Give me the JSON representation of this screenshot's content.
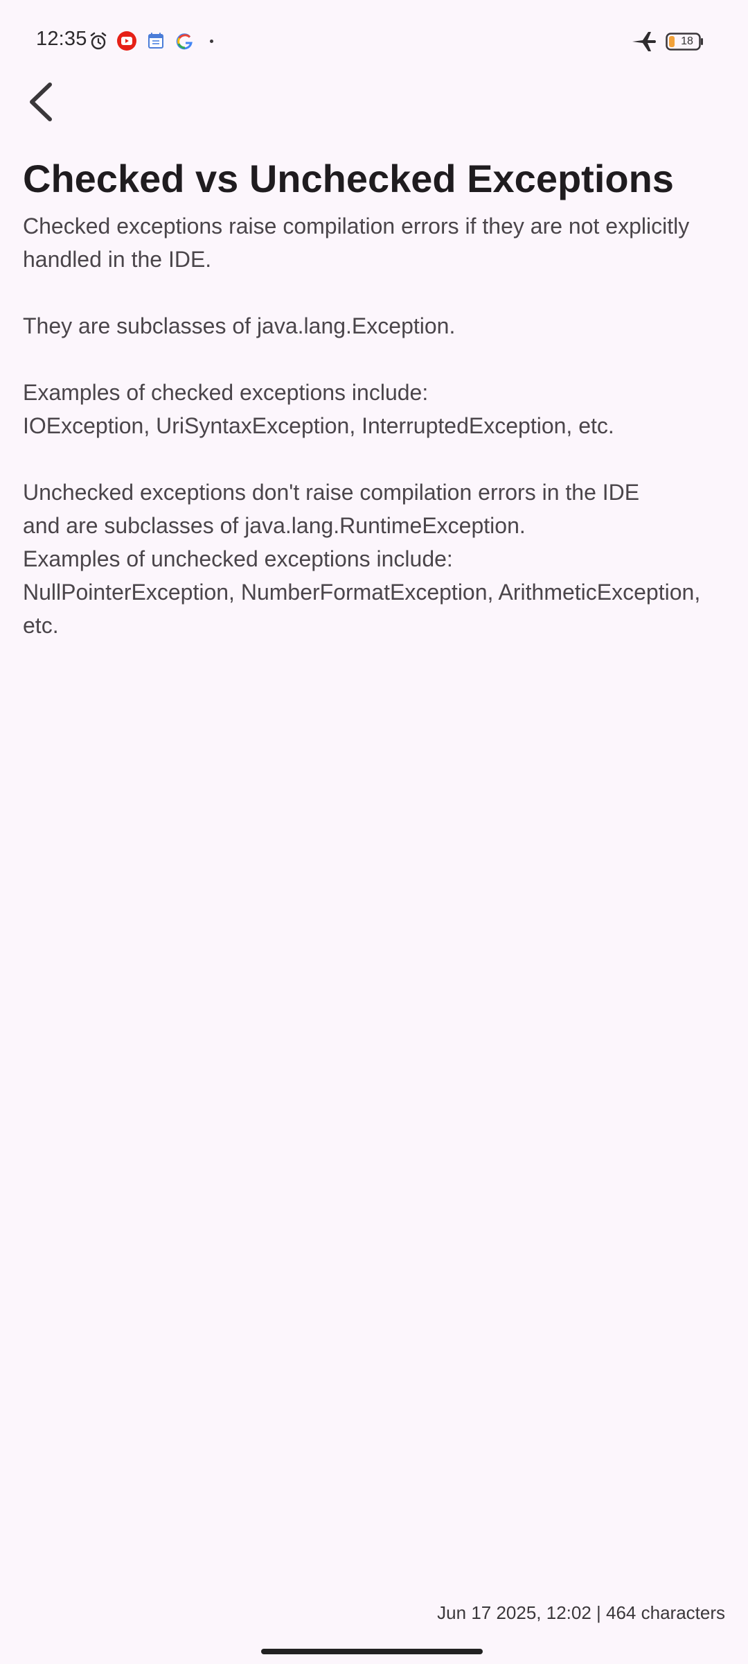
{
  "status_bar": {
    "time": "12:35",
    "icons": [
      "alarm-icon",
      "youtube-icon",
      "google-calendar-icon",
      "google-icon",
      "notification-dot-icon",
      "airplane-mode-icon",
      "battery-icon"
    ],
    "battery_level": "18"
  },
  "toolbar": {
    "back_icon": "back-arrow-icon"
  },
  "note": {
    "title": "Checked vs Unchecked Exceptions",
    "body": "Checked exceptions raise compilation errors if they are not explicitly handled in the IDE.\n\nThey are subclasses of java.lang.Exception.\n\nExamples of checked exceptions include:\nIOException, UriSyntaxException, InterruptedException, etc.\n\nUnchecked exceptions don't raise compilation errors in the IDE\nand are subclasses of java.lang.RuntimeException.\nExamples of unchecked exceptions include:\nNullPointerException, NumberFormatException, ArithmeticException, etc."
  },
  "footer": {
    "meta": "Jun 17 2025, 12:02 | 464 characters"
  },
  "colors": {
    "background": "#fcf6fc",
    "title_text": "#1f1c1f",
    "body_text": "#4a454a",
    "battery_fill": "#f2a23a",
    "youtube_red": "#e62117"
  }
}
